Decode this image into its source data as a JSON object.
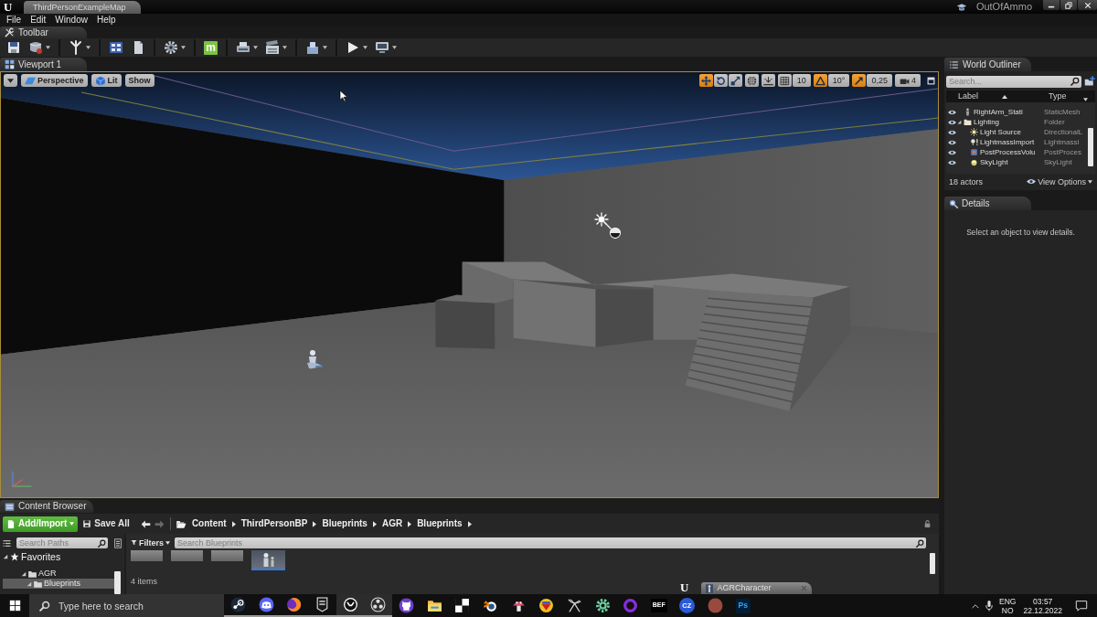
{
  "title_bar": {
    "logo": "U",
    "document_tab": "ThirdPersonExampleMap",
    "user": "OutOfAmmo"
  },
  "menu": [
    "File",
    "Edit",
    "Window",
    "Help"
  ],
  "toolbar": {
    "tab": "Toolbar",
    "groups": [
      [
        {
          "kind": "save",
          "dropdown": false
        },
        {
          "kind": "source_control",
          "dropdown": true
        }
      ],
      [
        {
          "kind": "modes",
          "dropdown": true
        }
      ],
      [
        {
          "kind": "content",
          "dropdown": false
        },
        {
          "kind": "document",
          "dropdown": false
        }
      ],
      [
        {
          "kind": "settings",
          "dropdown": true
        }
      ],
      [
        {
          "kind": "marketplace",
          "text": "m",
          "dropdown": false
        }
      ],
      [
        {
          "kind": "blueprints",
          "dropdown": true
        },
        {
          "kind": "cinematics",
          "dropdown": true
        }
      ],
      [
        {
          "kind": "build",
          "dropdown": true
        }
      ],
      [
        {
          "kind": "play",
          "dropdown": true
        },
        {
          "kind": "launch",
          "dropdown": true
        }
      ]
    ]
  },
  "viewport": {
    "tab": "Viewport 1",
    "view_buttons": [
      {
        "kind": "options"
      },
      {
        "kind": "perspective",
        "label": "Perspective"
      },
      {
        "kind": "lit",
        "label": "Lit"
      },
      {
        "kind": "show",
        "label": "Show"
      }
    ],
    "transform_modes": [
      {
        "kind": "translate",
        "selected": true
      },
      {
        "kind": "rotate",
        "selected": false
      },
      {
        "kind": "scale",
        "selected": false
      }
    ],
    "snapping": [
      {
        "kind": "surface",
        "on": false
      },
      {
        "kind": "grid",
        "on": false,
        "value": "10"
      },
      {
        "kind": "rotation",
        "on": true,
        "value": "10°"
      },
      {
        "kind": "scale",
        "on": true,
        "value": "0,25"
      }
    ],
    "camera_speed": "4"
  },
  "world_outliner": {
    "tab": "World Outliner",
    "search": {
      "placeholder": "Search..."
    },
    "columns": [
      {
        "label": "Label",
        "sorted": true
      },
      {
        "label": "Type",
        "sorted": false
      }
    ],
    "items": [
      {
        "kind": "static_mesh",
        "label": "RightArm_Stati",
        "type": "StaticMesh",
        "visible": true
      },
      {
        "kind": "folder",
        "label": "Lighting",
        "type": "Folder",
        "visible": true,
        "expanded": true,
        "children": [
          {
            "kind": "directional_light",
            "label": "Light Source",
            "type": "DirectionalL",
            "visible": true
          },
          {
            "kind": "lightmass_volume",
            "label": "LightmassImport",
            "type": "Lightmassi",
            "visible": true
          },
          {
            "kind": "post_process",
            "label": "PostProcessVolu",
            "type": "PostProces",
            "visible": true
          },
          {
            "kind": "sky_light",
            "label": "SkyLight",
            "type": "SkyLight",
            "visible": true
          }
        ]
      }
    ],
    "actor_count": "18 actors",
    "view_options": "View Options"
  },
  "details": {
    "tab": "Details",
    "message": "Select an object to view details."
  },
  "content_browser": {
    "tab": "Content Browser",
    "add_import": "Add/Import",
    "save_all": "Save All",
    "history": [
      {
        "kind": "back",
        "disabled": false
      },
      {
        "kind": "forward",
        "disabled": true
      }
    ],
    "path": [
      "Content",
      "ThirdPersonBP",
      "Blueprints",
      "AGR",
      "Blueprints"
    ],
    "path_search": {
      "placeholder": "Search Paths"
    },
    "favorites": {
      "label": "Favorites",
      "expanded": true
    },
    "folders": [
      {
        "label": "AGR",
        "expanded": true,
        "selected": false,
        "children": [
          {
            "label": "Blueprints",
            "expanded": true,
            "selected": true
          }
        ]
      }
    ],
    "filters": "Filters",
    "asset_search": {
      "placeholder": "Search Blueprints"
    },
    "assets": [
      {
        "kind": "blank",
        "selected": false
      },
      {
        "kind": "blank",
        "selected": false
      },
      {
        "kind": "blank",
        "selected": false
      },
      {
        "kind": "character",
        "selected": true
      }
    ],
    "item_count": "4 items"
  },
  "floating_tab": {
    "logo": "U",
    "label": "AGRCharacter"
  },
  "taskbar": {
    "search": {
      "placeholder": "Type here to search"
    },
    "apps": [
      {
        "kind": "steam",
        "running": true,
        "highlighted": false
      },
      {
        "kind": "discord",
        "running": true,
        "highlighted": false
      },
      {
        "kind": "firefox",
        "running": true,
        "highlighted": false
      },
      {
        "kind": "epic",
        "running": true,
        "highlighted": false
      },
      {
        "kind": "unreal",
        "running": true,
        "highlighted": true
      },
      {
        "kind": "obs",
        "running": true,
        "highlighted": true
      },
      {
        "kind": "github",
        "running": false,
        "highlighted": false
      },
      {
        "kind": "explorer",
        "running": false,
        "highlighted": false
      },
      {
        "kind": "pixel",
        "running": false,
        "highlighted": false
      },
      {
        "kind": "blender",
        "running": false,
        "highlighted": false
      },
      {
        "kind": "mushroom",
        "running": false,
        "highlighted": false
      },
      {
        "kind": "emblem",
        "running": false,
        "highlighted": false
      },
      {
        "kind": "dish",
        "running": false,
        "highlighted": false
      },
      {
        "kind": "gear",
        "running": false,
        "highlighted": false
      },
      {
        "kind": "ring",
        "running": false,
        "highlighted": false
      },
      {
        "kind": "bef",
        "text": "BEF",
        "running": false,
        "highlighted": false
      },
      {
        "kind": "cz",
        "text": "CZ",
        "running": false,
        "highlighted": false
      },
      {
        "kind": "avatar",
        "running": false,
        "highlighted": false
      },
      {
        "kind": "ps",
        "text": "Ps",
        "running": false,
        "highlighted": false
      }
    ],
    "language": "ENG",
    "layout": "NO",
    "time": "03:57",
    "date": "22.12.2022"
  }
}
